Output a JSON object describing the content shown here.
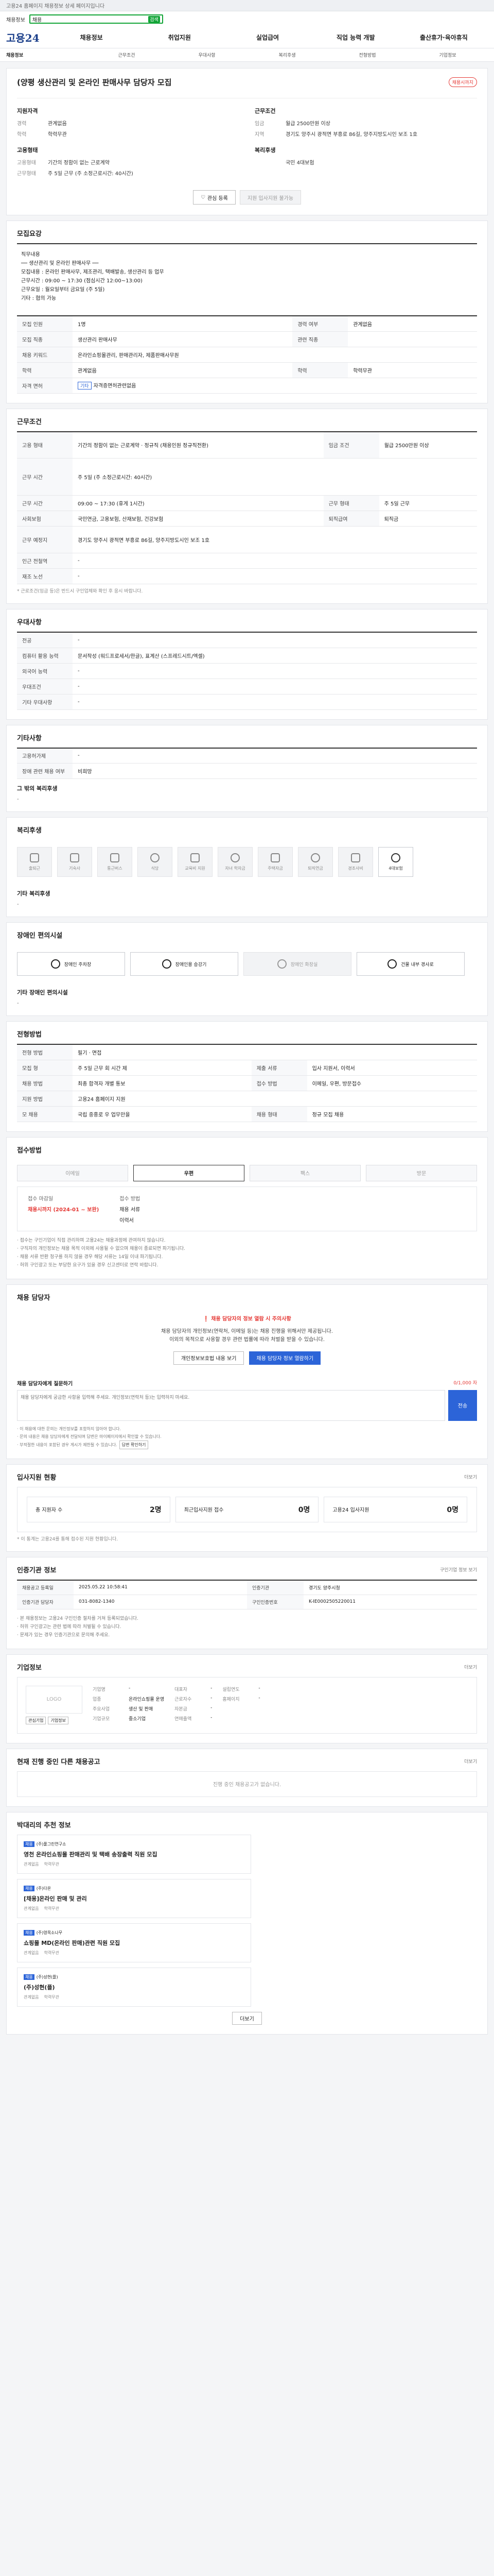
{
  "topbar": {
    "text": "고용24 홈페이지 채용정보 상세 페이지입니다"
  },
  "search": {
    "crumb": "채용정보",
    "value": "채용",
    "tag": "검색"
  },
  "gnb": {
    "logo": "고용24",
    "items": [
      "채용정보",
      "취업지원",
      "실업급여",
      "직업 능력 개발",
      "출산휴가·육아휴직"
    ]
  },
  "subnav": {
    "items": [
      "채용정보",
      "근무조건",
      "우대사항",
      "복리후생",
      "전형방법",
      "기업정보"
    ]
  },
  "job": {
    "title": "(양평 생산관리 및 온라인 판매사무 담당자 모집",
    "badge": "채용시까지",
    "sub": "",
    "left_h": "지원자격",
    "left_rows": [
      {
        "k": "경력",
        "v": "관계없음"
      },
      {
        "k": "학력",
        "v": "학력무관"
      }
    ],
    "left_h2": "고용형태",
    "left_rows2": [
      {
        "k": "고용형태",
        "v": "기간의 정함이 없는 근로계약"
      },
      {
        "k": "근무형태",
        "v": "주 5일 근무 (주 소정근로시간: 40시간)"
      }
    ],
    "right_h": "근무조건",
    "right_rows": [
      {
        "k": "임금",
        "v": "월급 2500만원 이상"
      },
      {
        "k": "지역",
        "v": "경기도 양주시 광적면 부흥로 86길, 양주지방도시인 보조 1호"
      }
    ],
    "right_h2": "복리후생",
    "right_rows2": [
      {
        "k": "",
        "v": "국민 4대보험"
      }
    ],
    "btn_save": "관심 등록",
    "btn_apply": "지원 입사지원 불가능"
  },
  "desc": {
    "title": "모집요강",
    "lines": [
      "직무내용",
      "── 생산관리 및 온라인 판매사무 ──",
      "모집내용 : 온라인 판매사무, 제조관리, 택배발송, 생산관리 등 업무",
      "근무시간 : 09:00 ~ 17:30 (점심시간 12:00~13:00)",
      "근무요일 : 월요일부터 금요일 (주 5일)",
      "기타 : 협의 가능"
    ]
  },
  "info_table": [
    {
      "k": "모집 인원",
      "v": "1명",
      "k2": "경력 여부",
      "v2": "관계없음"
    },
    {
      "k": "모집 직종",
      "v": "생산관리 판매사무",
      "k2": "관련 직종",
      "v2": ""
    },
    {
      "k": "채용 키워드",
      "v": "온라인쇼핑몰관리, 판매관리자, 제품판매사무원",
      "k2": "",
      "v2": ""
    },
    {
      "k": "학력",
      "v": "관계없음",
      "k2": "학력",
      "v2": "학력무관"
    },
    {
      "k": "자격 면허",
      "v": "자격증면허관련없음",
      "k2": "",
      "v2": ""
    }
  ],
  "work": {
    "title": "근무조건",
    "rows": [
      {
        "k": "고용 형태",
        "v": "기간의 정함이 없는 근로계약 · 정규직 (채용인원 정규직전환)",
        "k2": "임금 조건",
        "v2": "월급 2500만원 이상"
      },
      {
        "k": "근무 시간",
        "v": "주 5일 (주 소정근로시간: 40시간)",
        "k2": "",
        "v2": ""
      },
      {
        "k": "근무 시간",
        "v": "09:00 ~ 17:30 (휴게 1시간)",
        "k2": "근무 형태",
        "v2": "주 5일 근무"
      },
      {
        "k": "사회보험",
        "v": "국민연금, 고용보험, 산재보험, 건강보험",
        "k2": "퇴직급여",
        "v2": "퇴직금"
      },
      {
        "k": "근무 예정지",
        "v": "경기도 양주시 광적면 부흥로 86길, 양주지방도시인 보조 1호",
        "k2": "",
        "v2": ""
      },
      {
        "k": "인근 전철역",
        "v": "-",
        "k2": "",
        "v2": ""
      },
      {
        "k": "재조 노선",
        "v": "-",
        "k2": "",
        "v2": ""
      }
    ],
    "note": "* 근로조건(임금 등)은 반드시 구인업체와 확인 후 응시 바랍니다."
  },
  "pref": {
    "title": "우대사항",
    "rows": [
      {
        "k": "전공",
        "v": "-"
      },
      {
        "k": "컴퓨터 활용 능력",
        "v": "문서작성 (워드프로세서/한글), 표계산 (스프레드시트/엑셀)"
      },
      {
        "k": "외국어 능력",
        "v": "-"
      },
      {
        "k": "우대조건",
        "v": "-"
      },
      {
        "k": "기타 우대사항",
        "v": "-"
      }
    ]
  },
  "etc": {
    "title": "기타사항",
    "rows": [
      {
        "k": "고용허가제",
        "v": "-"
      },
      {
        "k": "장애 관련 채용 여부",
        "v": "비희망"
      }
    ],
    "sub_h": "그 밖의 복리후생",
    "sub_v": "-"
  },
  "welfare": {
    "title": "복리후생",
    "items": [
      {
        "label": "출퇴근",
        "on": false
      },
      {
        "label": "기숙사",
        "on": false
      },
      {
        "label": "통근버스",
        "on": false
      },
      {
        "label": "식당",
        "on": false
      },
      {
        "label": "교육비 지원",
        "on": false
      },
      {
        "label": "자녀 학자금",
        "on": false
      },
      {
        "label": "주택자금",
        "on": false
      },
      {
        "label": "퇴직연금",
        "on": false
      },
      {
        "label": "경조사비",
        "on": false
      },
      {
        "label": "4대보험",
        "on": true
      }
    ],
    "sub_h": "기타 복리후생",
    "sub_v": "-"
  },
  "disability": {
    "title": "장애인 편의시설",
    "items": [
      {
        "label": "장애인 주차장",
        "on": true
      },
      {
        "label": "장애인용 승강기",
        "on": true
      },
      {
        "label": "장애인 화장실",
        "on": false
      },
      {
        "label": "건물 내부 경사로",
        "on": true
      }
    ],
    "sub_h": "기타 장애인 편의시설",
    "sub_v": "-"
  },
  "selection": {
    "title": "전형방법",
    "rows": [
      {
        "k": "전형 방법",
        "v": "필기 · 면접",
        "k2": "",
        "v2": ""
      },
      {
        "k": "모집 형",
        "v": "주 5일 근무 회 시간 제",
        "k2": "제출 서류",
        "v2": "입사 지원서, 이력서"
      },
      {
        "k": "채용 방법",
        "v": "최종 합격자 개별 통보",
        "k2": "접수 방법",
        "v2": "이메일, 우편, 방문접수"
      },
      {
        "k": "지원 방법",
        "v": "고용24 홈페이지 지원",
        "k2": "",
        "v2": ""
      },
      {
        "k": "모 채용",
        "v": "국립 중흥로 우 업무만을",
        "k2": "채용 형태",
        "v2": "정규 모집 채용"
      }
    ]
  },
  "apply": {
    "title": "접수방법",
    "methods": [
      {
        "label": "이메일",
        "on": false
      },
      {
        "label": "우편",
        "on": true
      },
      {
        "label": "팩스",
        "on": false
      },
      {
        "label": "방문",
        "on": false
      }
    ],
    "k1": "접수 마감일",
    "v1": "채용시까지 (2024-01 ~ 보완)",
    "k2": "접수 방법",
    "v2": "채용 서류",
    "k3": "",
    "v3": "이력서",
    "bullets": [
      "· 접수는 구인기업이 직접 관리하며 고용24는 채용과정에 관여하지 않습니다.",
      "· 구직자의 개인정보는 채용 목적 이외에 사용될 수 없으며 채용이 종료되면 파기됩니다.",
      "· 채용 서류 반환 청구를 하지 않을 경우 해당 서류는 14일 이내 파기됩니다.",
      "· 허위 구인광고 또는 부당한 요구가 있을 경우 신고센터로 연락 바랍니다."
    ]
  },
  "contact": {
    "title": "채용 담당자",
    "warn": "채용 담당자의 정보 열람 시 주의사항",
    "txt1": "채용 담당자의 개인정보(연락처, 이메일 등)는 채용 진행을 위해서만 제공됩니다.",
    "txt2": "이외의 목적으로 사용할 경우 관련 법률에 따라 처벌을 받을 수 있습니다.",
    "btn1": "개인정보보호법 내용 보기",
    "btn2": "채용 담당자 정보 열람하기",
    "qa_label": "채용 담당자에게 질문하기",
    "qa_limit": "0/1,000 자",
    "qa_placeholder": "채용 담당자에게 궁금한 사항을 입력해 주세요. 개인정보(연락처 등)는 입력하지 마세요.",
    "send": "전송",
    "notes": [
      "· 이 채용에 대한 문의는 개인정보를 포함하지 않아야 합니다.",
      "· 문의 내용은 채용 담당자에게 전달되며 답변은 마이페이지에서 확인할 수 있습니다.",
      "· 부적절한 내용이 포함된 경우 게시가 제한될 수 있습니다."
    ],
    "mini_btn": "답변 확인하기"
  },
  "stats": {
    "title": "입사지원 현황",
    "more": "더보기",
    "items": [
      {
        "k": "총 지원자 수",
        "v": "2명"
      },
      {
        "k": "최근입사지원 접수",
        "v": "0명"
      },
      {
        "k": "고용24 입사지원",
        "v": "0명"
      }
    ],
    "note": "* 이 통계는 고용24를 통해 접수된 지원 현황입니다."
  },
  "req_info": {
    "title": "인증기관 정보",
    "more": "구인기업 정보 보기",
    "cells": [
      {
        "k": "채용공고 등록일",
        "v": "2025.05.22 10:58:41"
      },
      {
        "k": "인증기관",
        "v": "경기도 양주시청"
      },
      {
        "k": "인증기관 담당자",
        "v": "031-8082-1340"
      },
      {
        "k": "구인인증번호",
        "v": "K-IE0002505220011"
      }
    ],
    "bullets": [
      "· 본 채용정보는 고용24 구인인증 절차를 거쳐 등록되었습니다.",
      "· 허위 구인광고는 관련 법에 따라 처벌될 수 있습니다.",
      "· 문제가 있는 경우 인증기관으로 문의해 주세요."
    ]
  },
  "corp": {
    "title": "기업정보",
    "more": "더보기",
    "logo": "LOGO",
    "name": "",
    "btn_a": "관심기업",
    "btn_b": "기업정보",
    "col1": [
      {
        "k": "기업명",
        "v": "-"
      },
      {
        "k": "업종",
        "v": "온라인쇼핑몰 운영"
      },
      {
        "k": "주요사업",
        "v": "생산 및 판매"
      },
      {
        "k": "기업규모",
        "v": "중소기업"
      }
    ],
    "col2": [
      {
        "k": "대표자",
        "v": "-"
      },
      {
        "k": "근로자수",
        "v": "-"
      },
      {
        "k": "자본금",
        "v": "-"
      },
      {
        "k": "연매출액",
        "v": "-"
      }
    ],
    "col3": [
      {
        "k": "설립연도",
        "v": "-"
      },
      {
        "k": "홈페이지",
        "v": "-"
      }
    ]
  },
  "other": {
    "title": "현재 진행 중인 다른 채용공고",
    "more": "더보기",
    "empty": "진행 중인 채용공고가 없습니다."
  },
  "recommend": {
    "title": "박대리의 추천 정보",
    "items": [
      {
        "tag": "채용",
        "co": "(주)풀그린연구소",
        "name": "영천 온라인쇼핑몰 판매관리 및 택배 송장출력 직원 모집",
        "meta1": "관계없음",
        "meta2": "학력무관"
      },
      {
        "tag": "채용",
        "co": "(주)다온",
        "name": "[채용]온라인 판매 및 관리",
        "meta1": "관계없음",
        "meta2": "학력무관"
      },
      {
        "tag": "채용",
        "co": "(주)영목소나무",
        "name": "쇼핑몰 MD(온라인 판매)관련 직원 모집",
        "meta1": "관계없음",
        "meta2": "학력무관"
      },
      {
        "tag": "채용",
        "co": "(주)성현(플)",
        "name": "(주)성현(플)",
        "meta1": "관계없음",
        "meta2": "학력무관"
      }
    ],
    "more": "더보기"
  }
}
